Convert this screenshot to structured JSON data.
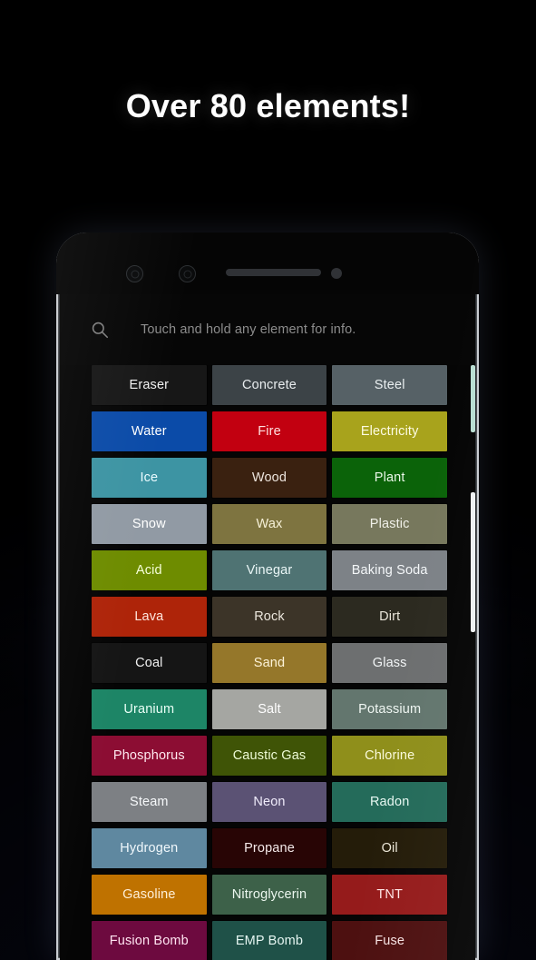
{
  "headline": "Over 80 elements!",
  "phone": {
    "bezel": {
      "sensor_left_name": "proximity-sensor",
      "sensor_right_name": "light-sensor",
      "earpiece_name": "earpiece-speaker",
      "camera_name": "front-camera"
    }
  },
  "search": {
    "icon": "search-icon",
    "placeholder": "Touch and hold any element for info."
  },
  "grid": {
    "columns": 3,
    "rows": [
      [
        {
          "label": "Eraser",
          "bg": "#171717",
          "fg": "#f0f0f0"
        },
        {
          "label": "Concrete",
          "bg": "#3c4347",
          "fg": "#e8ecee"
        },
        {
          "label": "Steel",
          "bg": "#566166",
          "fg": "#e9eef0"
        }
      ],
      [
        {
          "label": "Water",
          "bg": "#0b4ba8",
          "fg": "#ffffff"
        },
        {
          "label": "Fire",
          "bg": "#c20010",
          "fg": "#ffe0e0"
        },
        {
          "label": "Electricity",
          "bg": "#a8a31c",
          "fg": "#fdfbe2"
        }
      ],
      [
        {
          "label": "Ice",
          "bg": "#3d94a3",
          "fg": "#eafbff"
        },
        {
          "label": "Wood",
          "bg": "#3a2110",
          "fg": "#ece4dc"
        },
        {
          "label": "Plant",
          "bg": "#0b6309",
          "fg": "#eaf7e8"
        }
      ],
      [
        {
          "label": "Snow",
          "bg": "#919aa4",
          "fg": "#ffffff"
        },
        {
          "label": "Wax",
          "bg": "#7e7440",
          "fg": "#f7f1d8"
        },
        {
          "label": "Plastic",
          "bg": "#77785d",
          "fg": "#f0f0e8"
        }
      ],
      [
        {
          "label": "Acid",
          "bg": "#6e8c00",
          "fg": "#f6ffd9"
        },
        {
          "label": "Vinegar",
          "bg": "#4f7373",
          "fg": "#eaf6f6"
        },
        {
          "label": "Baking Soda",
          "bg": "#7d8287",
          "fg": "#f4f7f9"
        }
      ],
      [
        {
          "label": "Lava",
          "bg": "#ae2409",
          "fg": "#ffe6dd"
        },
        {
          "label": "Rock",
          "bg": "#3c3428",
          "fg": "#ebe6dc"
        },
        {
          "label": "Dirt",
          "bg": "#2c2a20",
          "fg": "#e8e4d8"
        }
      ],
      [
        {
          "label": "Coal",
          "bg": "#151515",
          "fg": "#f1f1f1"
        },
        {
          "label": "Sand",
          "bg": "#95772a",
          "fg": "#fdf3d8"
        },
        {
          "label": "Glass",
          "bg": "#6d6f70",
          "fg": "#f2f5f6"
        }
      ],
      [
        {
          "label": "Uranium",
          "bg": "#1d8566",
          "fg": "#e9fff6"
        },
        {
          "label": "Salt",
          "bg": "#a5a6a2",
          "fg": "#ffffff"
        },
        {
          "label": "Potassium",
          "bg": "#63766e",
          "fg": "#eff6f2"
        }
      ],
      [
        {
          "label": "Phosphorus",
          "bg": "#8c0d33",
          "fg": "#ffe9f0"
        },
        {
          "label": "Caustic Gas",
          "bg": "#3f5406",
          "fg": "#eefbd6"
        },
        {
          "label": "Chlorine",
          "bg": "#8f8f1b",
          "fg": "#fbfbdc"
        }
      ],
      [
        {
          "label": "Steam",
          "bg": "#7d8084",
          "fg": "#f6f8fa"
        },
        {
          "label": "Neon",
          "bg": "#5b5274",
          "fg": "#f0ecfb"
        },
        {
          "label": "Radon",
          "bg": "#246b5a",
          "fg": "#e7f8f2"
        }
      ],
      [
        {
          "label": "Hydrogen",
          "bg": "#5f88a0",
          "fg": "#f1f8fc"
        },
        {
          "label": "Propane",
          "bg": "#280505",
          "fg": "#f4e9e9"
        },
        {
          "label": "Oil",
          "bg": "#241c09",
          "fg": "#ece7d8"
        }
      ],
      [
        {
          "label": "Gasoline",
          "bg": "#bf7200",
          "fg": "#fff0d8"
        },
        {
          "label": "Nitroglycerin",
          "bg": "#3d6149",
          "fg": "#ecf7ef"
        },
        {
          "label": "TNT",
          "bg": "#951b1b",
          "fg": "#ffe7e7"
        }
      ],
      [
        {
          "label": "Fusion Bomb",
          "bg": "#6d0a3f",
          "fg": "#ffe4f1"
        },
        {
          "label": "EMP Bomb",
          "bg": "#1f5148",
          "fg": "#e6f6f2"
        },
        {
          "label": "Fuse",
          "bg": "#4d1010",
          "fg": "#f7e4e4"
        }
      ]
    ]
  },
  "scrollbar": {
    "thumb_primary_color": "#b9ded2",
    "thumb_secondary_color": "#eef1f3"
  }
}
